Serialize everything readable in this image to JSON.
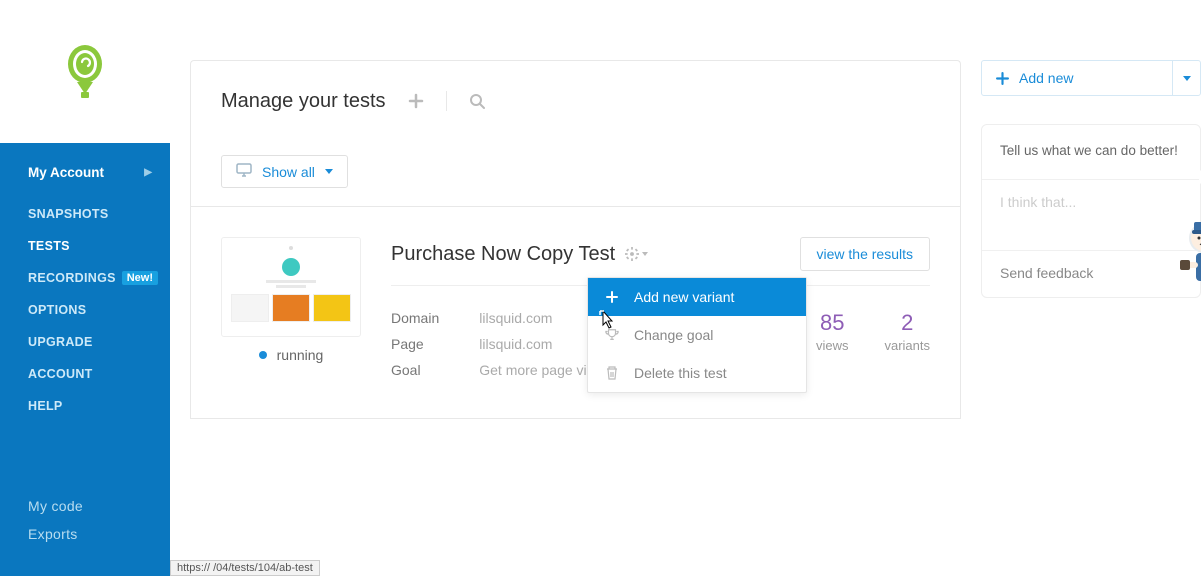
{
  "sidebar": {
    "account_label": "My Account",
    "items": [
      {
        "label": "SNAPSHOTS"
      },
      {
        "label": "TESTS"
      },
      {
        "label": "RECORDINGS",
        "badge": "New!"
      },
      {
        "label": "OPTIONS"
      },
      {
        "label": "UPGRADE"
      },
      {
        "label": "ACCOUNT"
      },
      {
        "label": "HELP"
      }
    ],
    "lower": [
      {
        "label": "My code"
      },
      {
        "label": "Exports"
      }
    ]
  },
  "header": {
    "title": "Manage your tests"
  },
  "toolbar": {
    "show_all_label": "Show all"
  },
  "test": {
    "title": "Purchase Now Copy Test",
    "status": "running",
    "view_results_label": "view the results",
    "meta_labels": {
      "domain": "Domain",
      "page": "Page",
      "goal": "Goal"
    },
    "meta_values": {
      "domain": "lilsquid.com",
      "page": "lilsquid.com",
      "goal": "Get more page vie"
    },
    "stats": {
      "views_num": "85",
      "views_label": "views",
      "variants_num": "2",
      "variants_label": "variants"
    }
  },
  "dropdown": {
    "items": [
      {
        "label": "Add new variant",
        "icon": "plus"
      },
      {
        "label": "Change goal",
        "icon": "trophy"
      },
      {
        "label": "Delete this test",
        "icon": "trash"
      }
    ]
  },
  "right": {
    "add_new_label": "Add new"
  },
  "feedback": {
    "prompt": "Tell us what we can do better!",
    "placeholder": "I think that...",
    "send_label": "Send feedback"
  }
}
